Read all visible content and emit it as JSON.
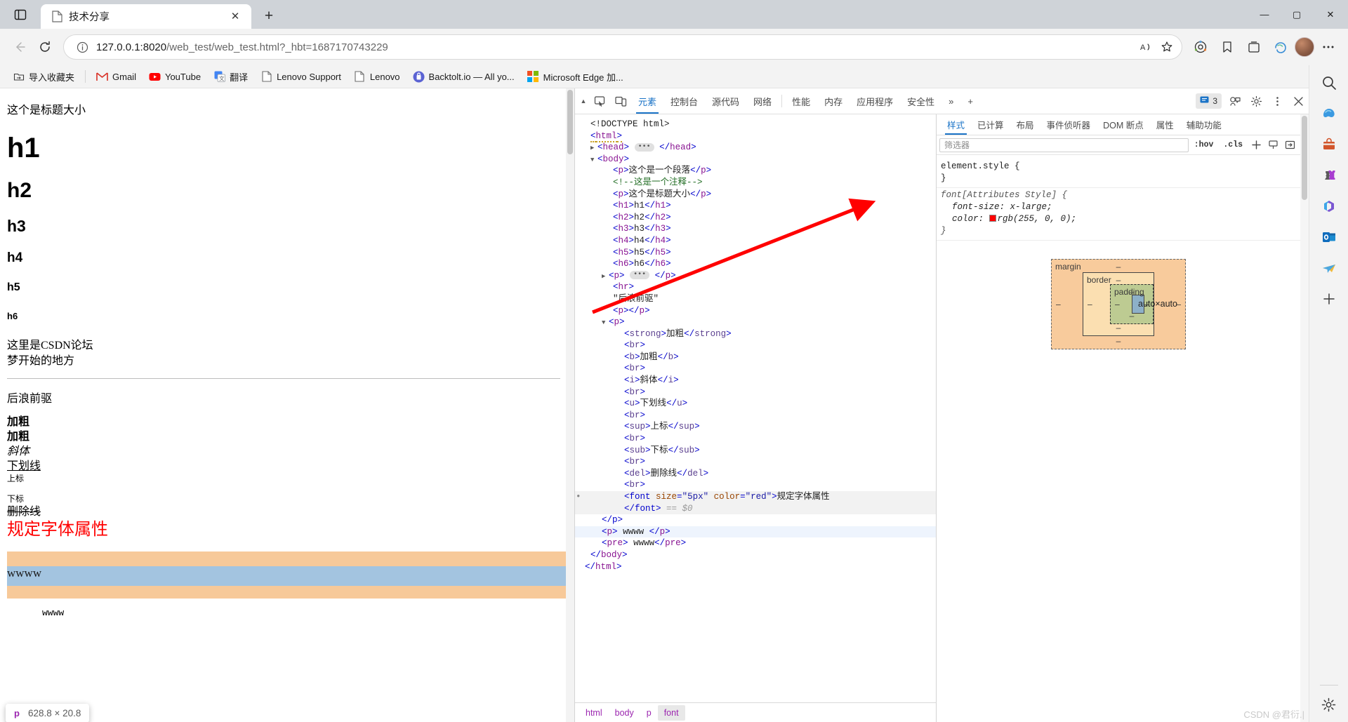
{
  "browser": {
    "tab": {
      "title": "技术分享",
      "close_label": "✕"
    },
    "new_tab_label": "+",
    "window_controls": {
      "minimize": "—",
      "maximize": "▢",
      "close": "✕"
    },
    "address": {
      "url_host": "127.0.0.1:8020",
      "url_path": "/web_test/web_test.html?_hbt=1687170743229",
      "read_aloud_label": "A",
      "favorite_label": "☆"
    },
    "bookmarks": [
      {
        "label": "导入收藏夹",
        "icon": "import-favorites-icon"
      },
      {
        "label": "Gmail",
        "icon": "gmail-icon"
      },
      {
        "label": "YouTube",
        "icon": "youtube-icon"
      },
      {
        "label": "翻译",
        "icon": "translate-icon"
      },
      {
        "label": "Lenovo Support",
        "icon": "page-icon"
      },
      {
        "label": "Lenovo",
        "icon": "page-icon"
      },
      {
        "label": "Backtolt.io — All yo...",
        "icon": "backtolt-icon"
      },
      {
        "label": "Microsoft Edge 加...",
        "icon": "microsoft-icon"
      }
    ]
  },
  "page": {
    "p_title_size": "这个是标题大小",
    "h1": "h1",
    "h2": "h2",
    "h3": "h3",
    "h4": "h4",
    "h5": "h5",
    "h6": "h6",
    "multiline_1": "这里是CSDN论坛",
    "multiline_2": "梦开始的地方",
    "quote": "后浪前驱",
    "strong": "加粗",
    "bold": "加粗",
    "italic": "斜体",
    "underline": "下划线",
    "sup": "上标",
    "sub": "下标",
    "del": "删除线",
    "font_attr": "规定字体属性",
    "highlight_p": "wwww",
    "pre": "wwww",
    "tooltip": {
      "tag": "p",
      "dimensions": "628.8 × 20.8"
    }
  },
  "devtools": {
    "tabs": [
      {
        "label": "元素",
        "active": true
      },
      {
        "label": "控制台",
        "active": false
      },
      {
        "label": "源代码",
        "active": false
      },
      {
        "label": "网络",
        "active": false
      },
      {
        "label": "性能",
        "active": false
      },
      {
        "label": "内存",
        "active": false
      },
      {
        "label": "应用程序",
        "active": false
      },
      {
        "label": "安全性",
        "active": false
      }
    ],
    "more_tabs_label": "»",
    "add_tab_label": "+",
    "issues_count": "3",
    "icons": {
      "inspect": "inspect-element-icon",
      "device": "device-toolbar-icon",
      "issues": "issues-icon",
      "devices_cloud": "remote-debug-icon",
      "settings": "gear-icon",
      "more": "more-options-icon",
      "close": "close-icon"
    },
    "dom_lines": [
      {
        "indent": 0,
        "type": "doctype",
        "text": "<!DOCTYPE html>"
      },
      {
        "indent": 0,
        "type": "tag",
        "name": "html",
        "text": "<html>"
      },
      {
        "indent": 0,
        "type": "collapsed",
        "name": "head",
        "text": "<head> … </head>"
      },
      {
        "indent": 0,
        "type": "open",
        "name": "body",
        "text": "<body>"
      },
      {
        "indent": 1,
        "type": "element",
        "tag": "p",
        "content": "这个是一个段落"
      },
      {
        "indent": 1,
        "type": "comment",
        "text": "<!--这是一个注释-->"
      },
      {
        "indent": 1,
        "type": "element",
        "tag": "p",
        "content": "这个是标题大小"
      },
      {
        "indent": 1,
        "type": "element",
        "tag": "h1",
        "content": "h1"
      },
      {
        "indent": 1,
        "type": "element",
        "tag": "h2",
        "content": "h2"
      },
      {
        "indent": 1,
        "type": "element",
        "tag": "h3",
        "content": "h3"
      },
      {
        "indent": 1,
        "type": "element",
        "tag": "h4",
        "content": "h4"
      },
      {
        "indent": 1,
        "type": "element",
        "tag": "h5",
        "content": "h5"
      },
      {
        "indent": 1,
        "type": "element",
        "tag": "h6",
        "content": "h6"
      },
      {
        "indent": 1,
        "type": "collapsed",
        "name": "p",
        "text": "<p> … </p>"
      },
      {
        "indent": 1,
        "type": "void",
        "tag": "hr"
      },
      {
        "indent": 1,
        "type": "text",
        "text": "\"后浪前驱\""
      },
      {
        "indent": 1,
        "type": "empty",
        "tag": "p"
      },
      {
        "indent": 1,
        "type": "open",
        "name": "p",
        "text": "<p>"
      },
      {
        "indent": 2,
        "type": "element",
        "tag": "strong",
        "content": "加粗"
      },
      {
        "indent": 2,
        "type": "void",
        "tag": "br"
      },
      {
        "indent": 2,
        "type": "element",
        "tag": "b",
        "content": "加粗"
      },
      {
        "indent": 2,
        "type": "void",
        "tag": "br"
      },
      {
        "indent": 2,
        "type": "element",
        "tag": "i",
        "content": "斜体"
      },
      {
        "indent": 2,
        "type": "void",
        "tag": "br"
      },
      {
        "indent": 2,
        "type": "element",
        "tag": "u",
        "content": "下划线"
      },
      {
        "indent": 2,
        "type": "void",
        "tag": "br"
      },
      {
        "indent": 2,
        "type": "element",
        "tag": "sup",
        "content": "上标"
      },
      {
        "indent": 2,
        "type": "void",
        "tag": "br"
      },
      {
        "indent": 2,
        "type": "element",
        "tag": "sub",
        "content": "下标"
      },
      {
        "indent": 2,
        "type": "void",
        "tag": "br"
      },
      {
        "indent": 2,
        "type": "element",
        "tag": "del",
        "content": "删除线"
      },
      {
        "indent": 2,
        "type": "void",
        "tag": "br"
      }
    ],
    "selected_node": {
      "open_tag": "<font",
      "attr1_name": "size",
      "attr1_value": "\"5px\"",
      "attr2_name": "color",
      "attr2_value": "\"red\"",
      "close_bracket": ">",
      "content": "规定字体属性",
      "close_tag": "</font>",
      "marker": "== $0"
    },
    "dom_tail": [
      {
        "text": "</p>"
      },
      {
        "text": "<p> wwww </p>",
        "highlight": "blue"
      },
      {
        "text": "<pre> wwww</pre>"
      },
      {
        "text": "</body>"
      },
      {
        "text": "</html>"
      }
    ],
    "breadcrumbs": [
      {
        "label": "html",
        "active": false
      },
      {
        "label": "body",
        "active": false
      },
      {
        "label": "p",
        "active": false
      },
      {
        "label": "font",
        "active": true
      }
    ],
    "styles": {
      "tabs": [
        {
          "label": "样式",
          "active": true
        },
        {
          "label": "已计算",
          "active": false
        },
        {
          "label": "布局",
          "active": false
        },
        {
          "label": "事件侦听器",
          "active": false
        },
        {
          "label": "DOM 断点",
          "active": false
        },
        {
          "label": "属性",
          "active": false
        },
        {
          "label": "辅助功能",
          "active": false
        }
      ],
      "filter_placeholder": "筛选器",
      "hov_label": ":hov",
      "cls_label": ".cls",
      "add_rule_label": "+",
      "rules": [
        {
          "selector": "element.style {",
          "props": [],
          "close": "}"
        },
        {
          "selector": "font[Attributes Style] {",
          "italic": true,
          "props": [
            {
              "name": "font-size",
              "value": "x-large;",
              "swatch": null
            },
            {
              "name": "color",
              "value": "rgb(255, 0, 0);",
              "swatch": "#ff0000"
            }
          ],
          "close": "}"
        }
      ],
      "box_model": {
        "margin_label": "margin",
        "border_label": "border",
        "padding_label": "padding",
        "content_label": "auto×auto",
        "dash": "‒"
      }
    }
  },
  "edge_sidebar": {
    "icons": [
      "search-icon",
      "copilot-icon",
      "shopping-bag-icon",
      "games-icon",
      "microsoft365-icon",
      "outlook-icon",
      "telegram-icon",
      "add-icon",
      "settings-gear-icon"
    ]
  },
  "watermark": "CSDN @君衍.|"
}
